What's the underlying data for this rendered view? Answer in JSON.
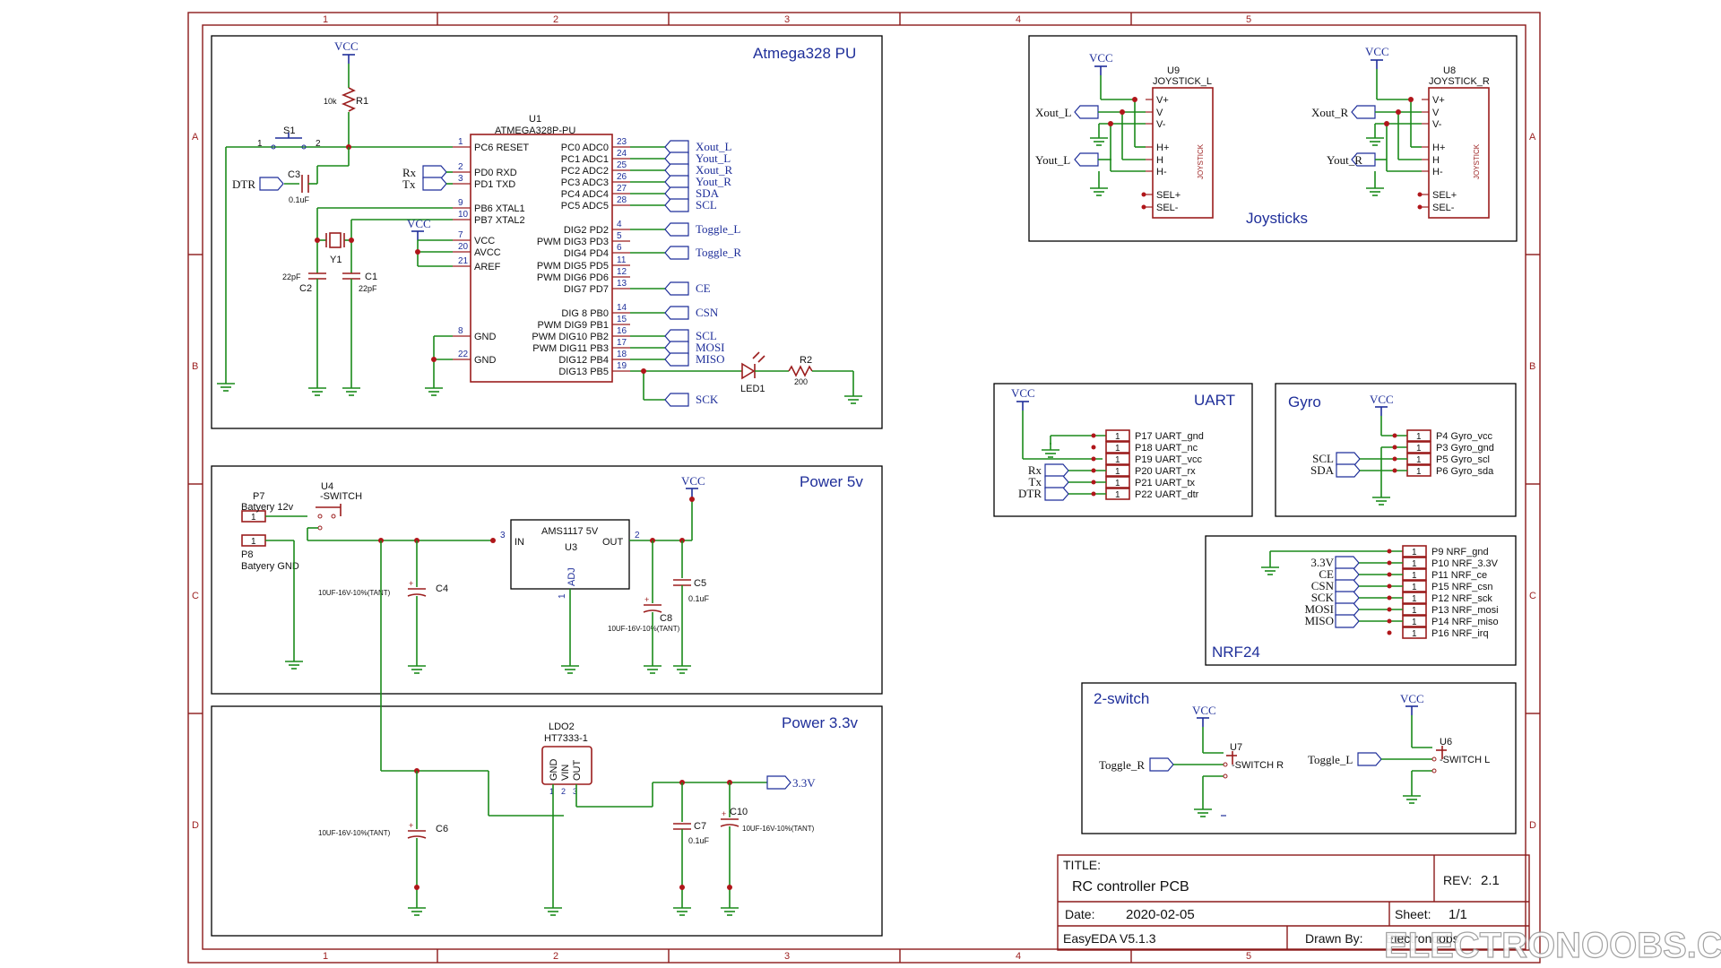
{
  "frame": {
    "columns": [
      "1",
      "2",
      "3",
      "4",
      "5"
    ],
    "rows": [
      "A",
      "B",
      "C",
      "D"
    ]
  },
  "sections": {
    "mcu": "Atmega328 PU",
    "joysticks": "Joysticks",
    "uart": "UART",
    "gyro": "Gyro",
    "power5": "Power 5v",
    "nrf": "NRF24",
    "power33": "Power 3.3v",
    "switch2": "2-switch"
  },
  "mcu": {
    "ref": "U1",
    "part": "ATMEGA328P-PU",
    "left_pins": [
      {
        "num": "1",
        "name": "PC6 RESET"
      },
      {
        "num": "2",
        "name": "PD0 RXD"
      },
      {
        "num": "3",
        "name": "PD1 TXD"
      },
      {
        "num": "9",
        "name": "PB6 XTAL1"
      },
      {
        "num": "10",
        "name": "PB7 XTAL2"
      },
      {
        "num": "7",
        "name": "VCC"
      },
      {
        "num": "20",
        "name": "AVCC"
      },
      {
        "num": "21",
        "name": "AREF"
      },
      {
        "num": "8",
        "name": "GND"
      },
      {
        "num": "22",
        "name": "GND"
      }
    ],
    "right_pins": [
      {
        "num": "23",
        "name": "PC0 ADC0",
        "net": "Xout_L"
      },
      {
        "num": "24",
        "name": "PC1 ADC1",
        "net": "Yout_L"
      },
      {
        "num": "25",
        "name": "PC2 ADC2",
        "net": "Xout_R"
      },
      {
        "num": "26",
        "name": "PC3 ADC3",
        "net": "Yout_R"
      },
      {
        "num": "27",
        "name": "PC4 ADC4",
        "net": "SDA"
      },
      {
        "num": "28",
        "name": "PC5 ADC5",
        "net": "SCL"
      },
      {
        "num": "4",
        "name": "DIG2 PD2",
        "net": "Toggle_L"
      },
      {
        "num": "5",
        "name": "PWM DIG3 PD3",
        "net": ""
      },
      {
        "num": "6",
        "name": "DIG4 PD4",
        "net": "Toggle_R"
      },
      {
        "num": "11",
        "name": "PWM DIG5 PD5",
        "net": ""
      },
      {
        "num": "12",
        "name": "PWM DIG6 PD6",
        "net": ""
      },
      {
        "num": "13",
        "name": "DIG7 PD7",
        "net": "CE"
      },
      {
        "num": "14",
        "name": "DIG 8 PB0",
        "net": "CSN"
      },
      {
        "num": "15",
        "name": "PWM DIG9 PB1",
        "net": ""
      },
      {
        "num": "16",
        "name": "PWM DIG10 PB2",
        "net": "SCL"
      },
      {
        "num": "17",
        "name": "PWM DIG11 PB3",
        "net": "MOSI"
      },
      {
        "num": "18",
        "name": "DIG12 PB4",
        "net": "MISO"
      },
      {
        "num": "19",
        "name": "DIG13 PB5",
        "net": ""
      }
    ],
    "sck_label": "SCK",
    "vcc": "VCC",
    "r1": {
      "ref": "R1",
      "value": "10k"
    },
    "s1": {
      "ref": "S1",
      "pin1": "1",
      "pin2": "2"
    },
    "c3": {
      "ref": "C3",
      "value": "0.1uF"
    },
    "dtr": "DTR",
    "rx": "Rx",
    "tx": "Tx",
    "y1": "Y1",
    "c1": {
      "ref": "C1",
      "value": "22pF"
    },
    "c2": {
      "ref": "C2",
      "value": "22pF"
    },
    "led": "LED1",
    "r2": {
      "ref": "R2",
      "value": "200"
    }
  },
  "joysticks": {
    "left": {
      "ref": "U9",
      "part": "JOYSTICK_L",
      "xout": "Xout_L",
      "yout": "Yout_L"
    },
    "right": {
      "ref": "U8",
      "part": "JOYSTICK_R",
      "xout": "Xout_R",
      "yout": "Yout_R"
    },
    "pins": [
      "V+",
      "V",
      "V-",
      "H+",
      "H",
      "H-",
      "SEL+",
      "SEL-"
    ],
    "body_label": "JOYSTICK",
    "vcc": "VCC"
  },
  "uart": {
    "vcc": "VCC",
    "nets": [
      "Rx",
      "Tx",
      "DTR"
    ],
    "pins": [
      {
        "num": "1",
        "label": "P17 UART_gnd"
      },
      {
        "num": "1",
        "label": "P18 UART_nc"
      },
      {
        "num": "1",
        "label": "P19 UART_vcc"
      },
      {
        "num": "1",
        "label": "P20 UART_rx"
      },
      {
        "num": "1",
        "label": "P21 UART_tx"
      },
      {
        "num": "1",
        "label": "P22 UART_dtr"
      }
    ]
  },
  "gyro": {
    "vcc": "VCC",
    "nets": [
      "SCL",
      "SDA"
    ],
    "pins": [
      {
        "num": "1",
        "label": "P4 Gyro_vcc"
      },
      {
        "num": "1",
        "label": "P3 Gyro_gnd"
      },
      {
        "num": "1",
        "label": "P5 Gyro_scl"
      },
      {
        "num": "1",
        "label": "P6 Gyro_sda"
      }
    ]
  },
  "power5": {
    "p7": {
      "ref": "P7",
      "label": "Batyery 12v",
      "num": "1"
    },
    "p8": {
      "ref": "P8",
      "label": "Batyery GND",
      "num": "1"
    },
    "u4": {
      "ref": "U4",
      "label": "-SWITCH"
    },
    "u3": {
      "ref": "U3",
      "part": "AMS1117 5V",
      "in": "IN",
      "out": "OUT",
      "adj": "ADJ",
      "pin_in": "3",
      "pin_out": "2",
      "pin_adj": "1"
    },
    "c4": {
      "ref": "C4",
      "value": "10UF-16V-10%(TANT)"
    },
    "c5": {
      "ref": "C5",
      "value": "0.1uF"
    },
    "c8": {
      "ref": "C8",
      "value": "10UF-16V-10%(TANT)"
    },
    "vcc": "VCC"
  },
  "nrf": {
    "nets": [
      "3.3V",
      "CE",
      "CSN",
      "SCK",
      "MOSI",
      "MISO"
    ],
    "pins": [
      {
        "num": "1",
        "label": "P9   NRF_gnd"
      },
      {
        "num": "1",
        "label": "P10 NRF_3.3V"
      },
      {
        "num": "1",
        "label": "P11 NRF_ce"
      },
      {
        "num": "1",
        "label": "P15 NRF_csn"
      },
      {
        "num": "1",
        "label": "P12 NRF_sck"
      },
      {
        "num": "1",
        "label": "P13 NRF_mosi"
      },
      {
        "num": "1",
        "label": "P14 NRF_miso"
      },
      {
        "num": "1",
        "label": "P16 NRF_irq"
      }
    ]
  },
  "power33": {
    "ldo": {
      "ref": "LDO2",
      "part": "HT7333-1",
      "pins": [
        "GND",
        "VIN",
        "OUT"
      ],
      "nums": [
        "1",
        "2",
        "3"
      ]
    },
    "c6": {
      "ref": "C6",
      "value": "10UF-16V-10%(TANT)"
    },
    "c7": {
      "ref": "C7",
      "value": "0.1uF"
    },
    "c10": {
      "ref": "C10",
      "value": "10UF-16V-10%(TANT)"
    },
    "out_net": "3.3V"
  },
  "switch2": {
    "u7": {
      "ref": "U7",
      "label": "-SWITCH R",
      "net": "Toggle_R"
    },
    "u6": {
      "ref": "U6",
      "label": "-SWITCH L",
      "net": "Toggle_L"
    },
    "vcc": "VCC"
  },
  "titleblock": {
    "title_label": "TITLE:",
    "title": "RC controller PCB",
    "rev_label": "REV:",
    "rev": "2.1",
    "date_label": "Date:",
    "date": "2020-02-05",
    "sheet_label": "Sheet:",
    "sheet": "1/1",
    "tool": "EasyEDA V5.1.3",
    "drawn_label": "Drawn By:",
    "drawn": "Electronoobs"
  },
  "watermark": "ELECTRONOOBS.COM"
}
